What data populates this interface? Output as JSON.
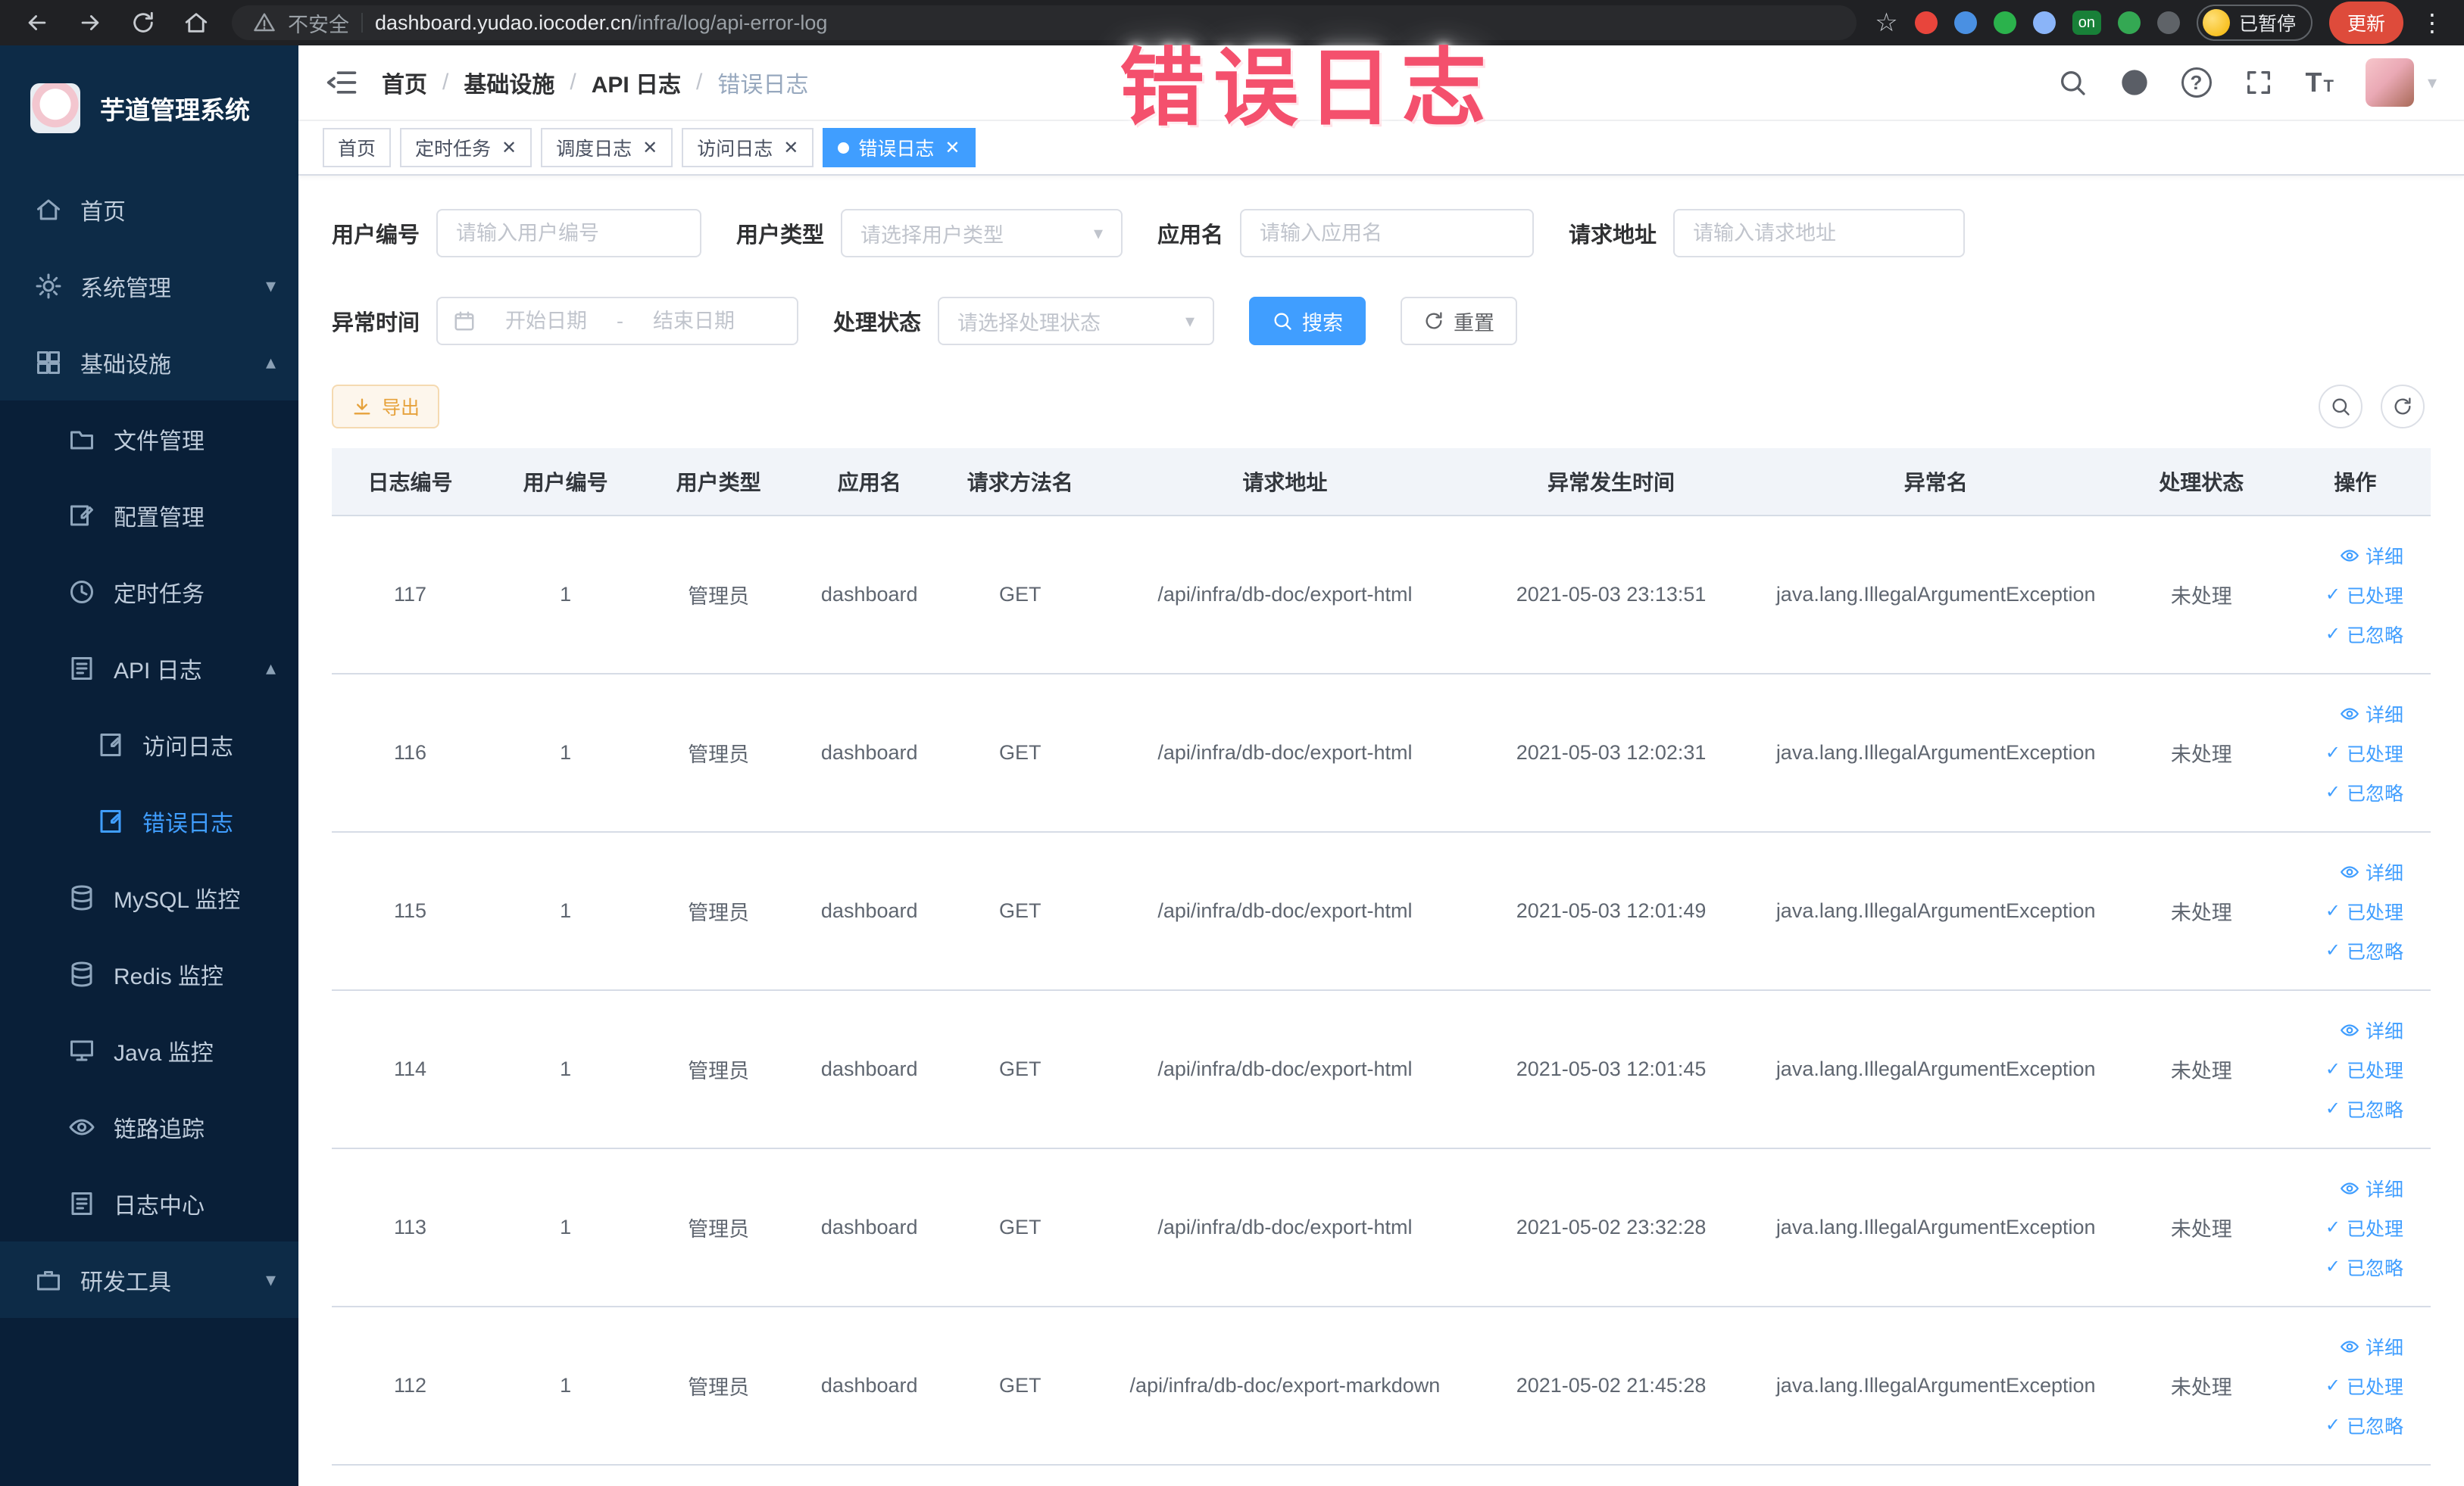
{
  "browser": {
    "security_label": "不安全",
    "url_host": "dashboard.yudao.iocoder.cn",
    "url_path": "/infra/log/api-error-log",
    "extensions_badge": "on",
    "paused_badge": "已暂停",
    "update_button": "更新"
  },
  "annotation": {
    "text": "错误日志"
  },
  "sidebar": {
    "logo_title": "芋道管理系统",
    "items": {
      "home": "首页",
      "system": "系统管理",
      "infra": "基础设施",
      "file": "文件管理",
      "config": "配置管理",
      "job": "定时任务",
      "api_log": "API 日志",
      "access_log": "访问日志",
      "error_log": "错误日志",
      "mysql": "MySQL 监控",
      "redis": "Redis 监控",
      "java": "Java 监控",
      "trace": "链路追踪",
      "log_center": "日志中心",
      "dev_tools": "研发工具"
    }
  },
  "breadcrumb": {
    "items": [
      "首页",
      "基础设施",
      "API 日志",
      "错误日志"
    ]
  },
  "tabs": {
    "labels": [
      "首页",
      "定时任务",
      "调度日志",
      "访问日志",
      "错误日志"
    ]
  },
  "filters": {
    "user_id_label": "用户编号",
    "user_id_placeholder": "请输入用户编号",
    "user_type_label": "用户类型",
    "user_type_placeholder": "请选择用户类型",
    "app_name_label": "应用名",
    "app_name_placeholder": "请输入应用名",
    "request_url_label": "请求地址",
    "request_url_placeholder": "请输入请求地址",
    "exception_time_label": "异常时间",
    "date_start_placeholder": "开始日期",
    "date_separator": "-",
    "date_end_placeholder": "结束日期",
    "process_status_label": "处理状态",
    "process_status_placeholder": "请选择处理状态",
    "search_button": "搜索",
    "reset_button": "重置"
  },
  "toolbar": {
    "export_button": "导出"
  },
  "table": {
    "columns": [
      "日志编号",
      "用户编号",
      "用户类型",
      "应用名",
      "请求方法名",
      "请求地址",
      "异常发生时间",
      "异常名",
      "处理状态",
      "操作"
    ],
    "action_detail": "详细",
    "action_processed": "已处理",
    "action_ignored": "已忽略",
    "rows": [
      {
        "id": "117",
        "user_id": "1",
        "user_type": "管理员",
        "app_name": "dashboard",
        "method": "GET",
        "url": "/api/infra/db-doc/export-html",
        "time": "2021-05-03 23:13:51",
        "exception": "java.lang.IllegalArgumentException",
        "status": "未处理"
      },
      {
        "id": "116",
        "user_id": "1",
        "user_type": "管理员",
        "app_name": "dashboard",
        "method": "GET",
        "url": "/api/infra/db-doc/export-html",
        "time": "2021-05-03 12:02:31",
        "exception": "java.lang.IllegalArgumentException",
        "status": "未处理"
      },
      {
        "id": "115",
        "user_id": "1",
        "user_type": "管理员",
        "app_name": "dashboard",
        "method": "GET",
        "url": "/api/infra/db-doc/export-html",
        "time": "2021-05-03 12:01:49",
        "exception": "java.lang.IllegalArgumentException",
        "status": "未处理"
      },
      {
        "id": "114",
        "user_id": "1",
        "user_type": "管理员",
        "app_name": "dashboard",
        "method": "GET",
        "url": "/api/infra/db-doc/export-html",
        "time": "2021-05-03 12:01:45",
        "exception": "java.lang.IllegalArgumentException",
        "status": "未处理"
      },
      {
        "id": "113",
        "user_id": "1",
        "user_type": "管理员",
        "app_name": "dashboard",
        "method": "GET",
        "url": "/api/infra/db-doc/export-html",
        "time": "2021-05-02 23:32:28",
        "exception": "java.lang.IllegalArgumentException",
        "status": "未处理"
      },
      {
        "id": "112",
        "user_id": "1",
        "user_type": "管理员",
        "app_name": "dashboard",
        "method": "GET",
        "url": "/api/infra/db-doc/export-markdown",
        "time": "2021-05-02 21:45:28",
        "exception": "java.lang.IllegalArgumentException",
        "status": "未处理"
      }
    ]
  }
}
